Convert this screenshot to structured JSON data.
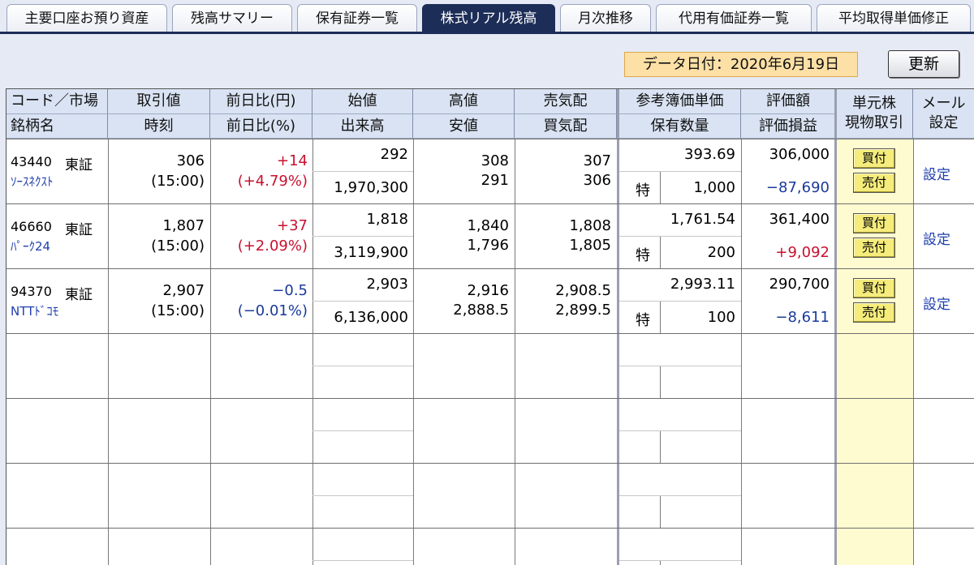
{
  "tabs": [
    {
      "label": "主要口座お預り資産",
      "active": false
    },
    {
      "label": "残高サマリー",
      "active": false
    },
    {
      "label": "保有証券一覧",
      "active": false
    },
    {
      "label": "株式リアル残高",
      "active": true
    },
    {
      "label": "月次推移",
      "active": false
    },
    {
      "label": "代用有価証券一覧",
      "active": false
    },
    {
      "label": "平均取得単価修正",
      "active": false
    }
  ],
  "data_date": "データ日付：2020年6月19日",
  "refresh_label": "更新",
  "headers": {
    "code_market": "コード／市場",
    "name": "銘柄名",
    "price": "取引値",
    "time": "時刻",
    "change_yen": "前日比(円)",
    "change_pct": "前日比(%)",
    "open": "始値",
    "volume": "出来高",
    "high": "高値",
    "low": "安値",
    "ask": "売気配",
    "bid": "買気配",
    "ref_cost": "参考簿価単価",
    "quantity": "保有数量",
    "valuation": "評価額",
    "pl": "評価損益",
    "unit_trade": "単元株 現物取引",
    "unit_trade_l1": "単元株",
    "unit_trade_l2": "現物取引",
    "mail": "メール 設定",
    "mail_l1": "メール",
    "mail_l2": "設定"
  },
  "rows": [
    {
      "code": "43440",
      "market": "東証",
      "name": "ｿｰｽﾈｸｽﾄ",
      "price": "306",
      "time": "(15:00)",
      "change": "+14",
      "change_pct": "(+4.79%)",
      "dir": "up",
      "open": "292",
      "volume": "1,970,300",
      "high": "308",
      "low": "291",
      "ask": "307",
      "bid": "306",
      "ref_cost": "393.69",
      "account": "特",
      "quantity": "1,000",
      "valuation": "306,000",
      "pl": "−87,690",
      "pl_dir": "down",
      "buy": "買付",
      "sell": "売付",
      "setting": "設定"
    },
    {
      "code": "46660",
      "market": "東証",
      "name": "ﾊﾟｰｸ24",
      "price": "1,807",
      "time": "(15:00)",
      "change": "+37",
      "change_pct": "(+2.09%)",
      "dir": "up",
      "open": "1,818",
      "volume": "3,119,900",
      "high": "1,840",
      "low": "1,796",
      "ask": "1,808",
      "bid": "1,805",
      "ref_cost": "1,761.54",
      "account": "特",
      "quantity": "200",
      "valuation": "361,400",
      "pl": "+9,092",
      "pl_dir": "up",
      "buy": "買付",
      "sell": "売付",
      "setting": "設定"
    },
    {
      "code": "94370",
      "market": "東証",
      "name": "NTTﾄﾞｺﾓ",
      "price": "2,907",
      "time": "(15:00)",
      "change": "−0.5",
      "change_pct": "(−0.01%)",
      "dir": "down",
      "open": "2,903",
      "volume": "6,136,000",
      "high": "2,916",
      "low": "2,888.5",
      "ask": "2,908.5",
      "bid": "2,899.5",
      "ref_cost": "2,993.11",
      "account": "特",
      "quantity": "100",
      "valuation": "290,700",
      "pl": "−8,611",
      "pl_dir": "down",
      "buy": "買付",
      "sell": "売付",
      "setting": "設定"
    }
  ],
  "colors": {
    "up": "#c8102e",
    "down": "#1a3a9c",
    "header_bg": "#d9e3f3",
    "tab_active": "#1c2d57",
    "trade_bg": "#fffbd0"
  }
}
